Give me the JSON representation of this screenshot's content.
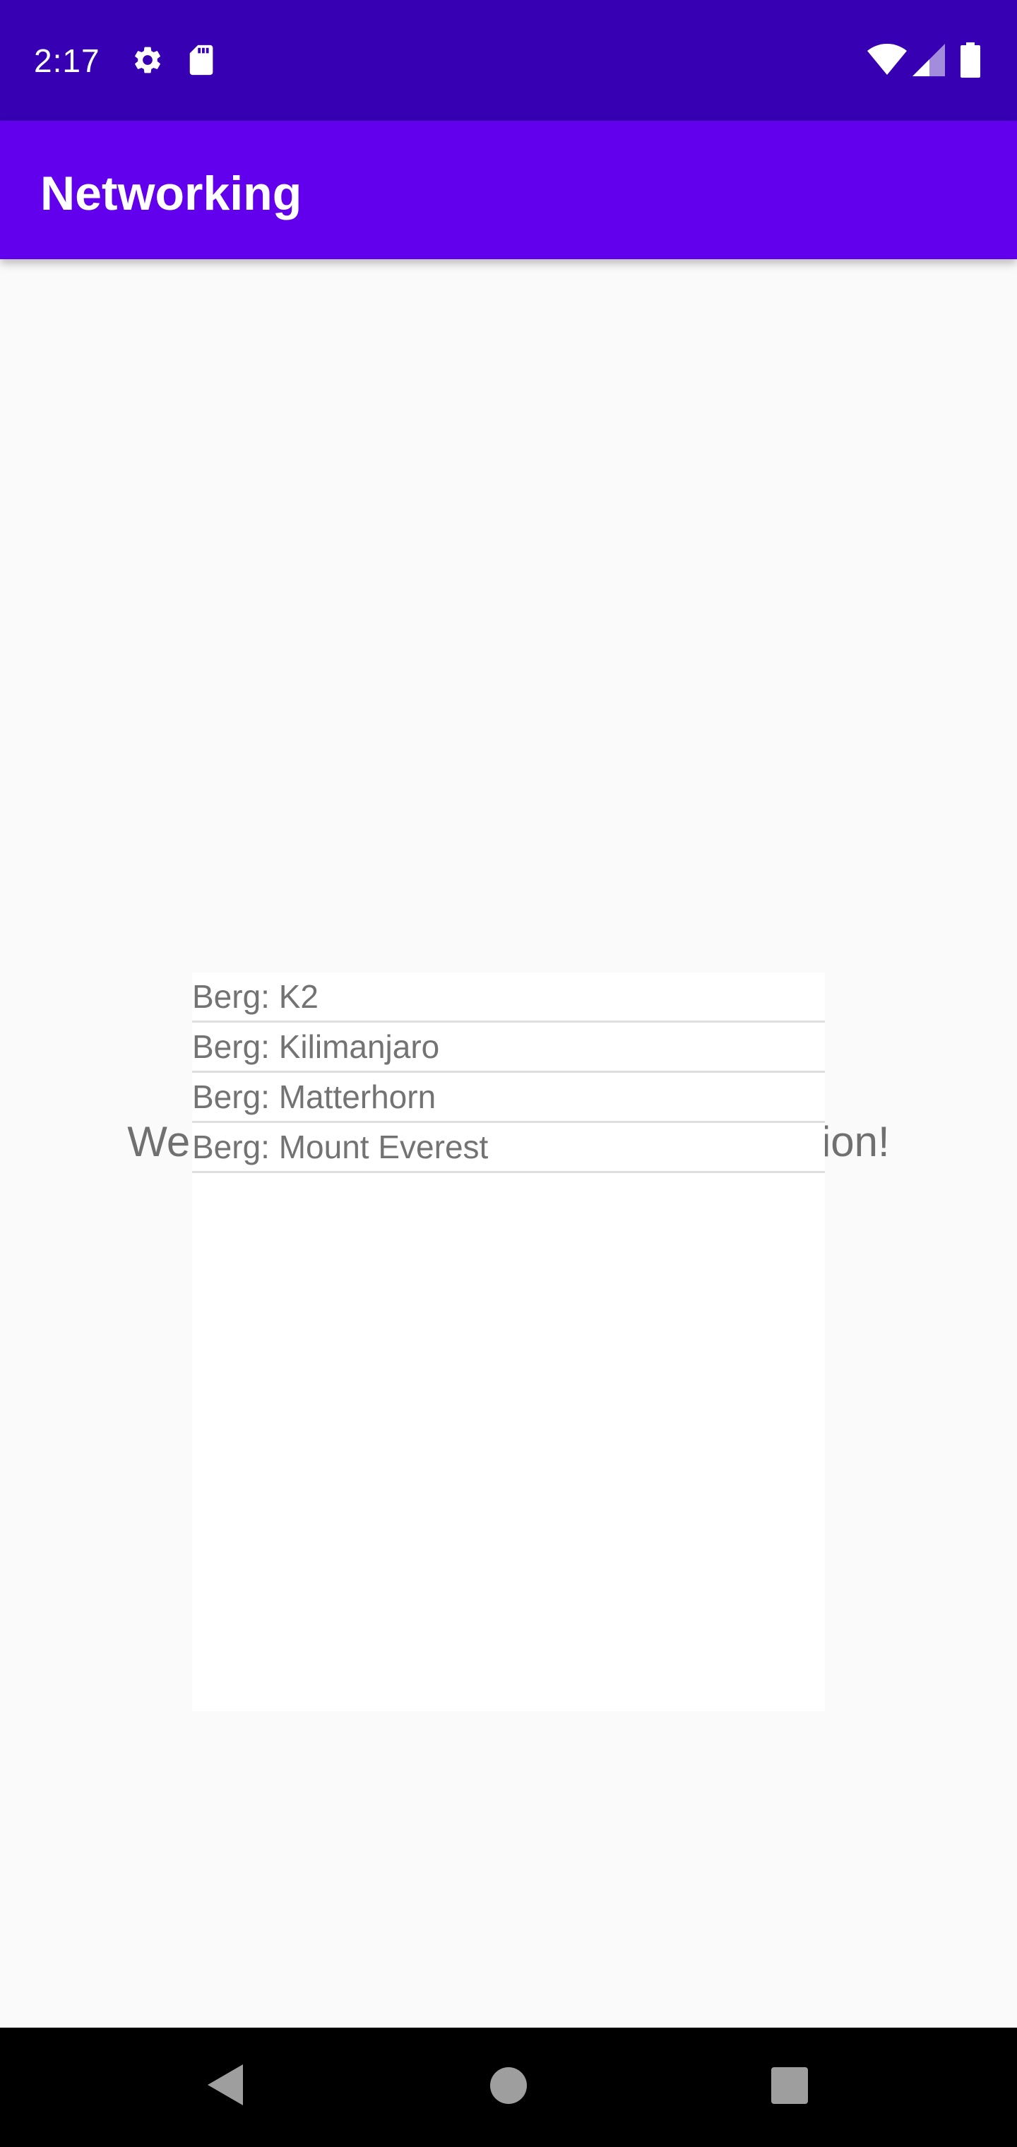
{
  "status_bar": {
    "time": "2:17",
    "icons": [
      "gear-icon",
      "sd-card-icon",
      "wifi-icon",
      "cell-signal-icon",
      "battery-icon"
    ]
  },
  "app_bar": {
    "title": "Networking"
  },
  "main": {
    "welcome_text": "Welcome to JSON Mountain Application!",
    "mountains": [
      "Berg: K2",
      "Berg: Kilimanjaro",
      "Berg: Matterhorn",
      "Berg: Mount Everest"
    ]
  },
  "nav_bar": {
    "buttons": [
      "back-icon",
      "home-icon",
      "recents-icon"
    ]
  },
  "colors": {
    "status_bar": "#3700b3",
    "app_bar": "#6200ee",
    "background": "#fafafa",
    "text_gray": "#707070"
  }
}
